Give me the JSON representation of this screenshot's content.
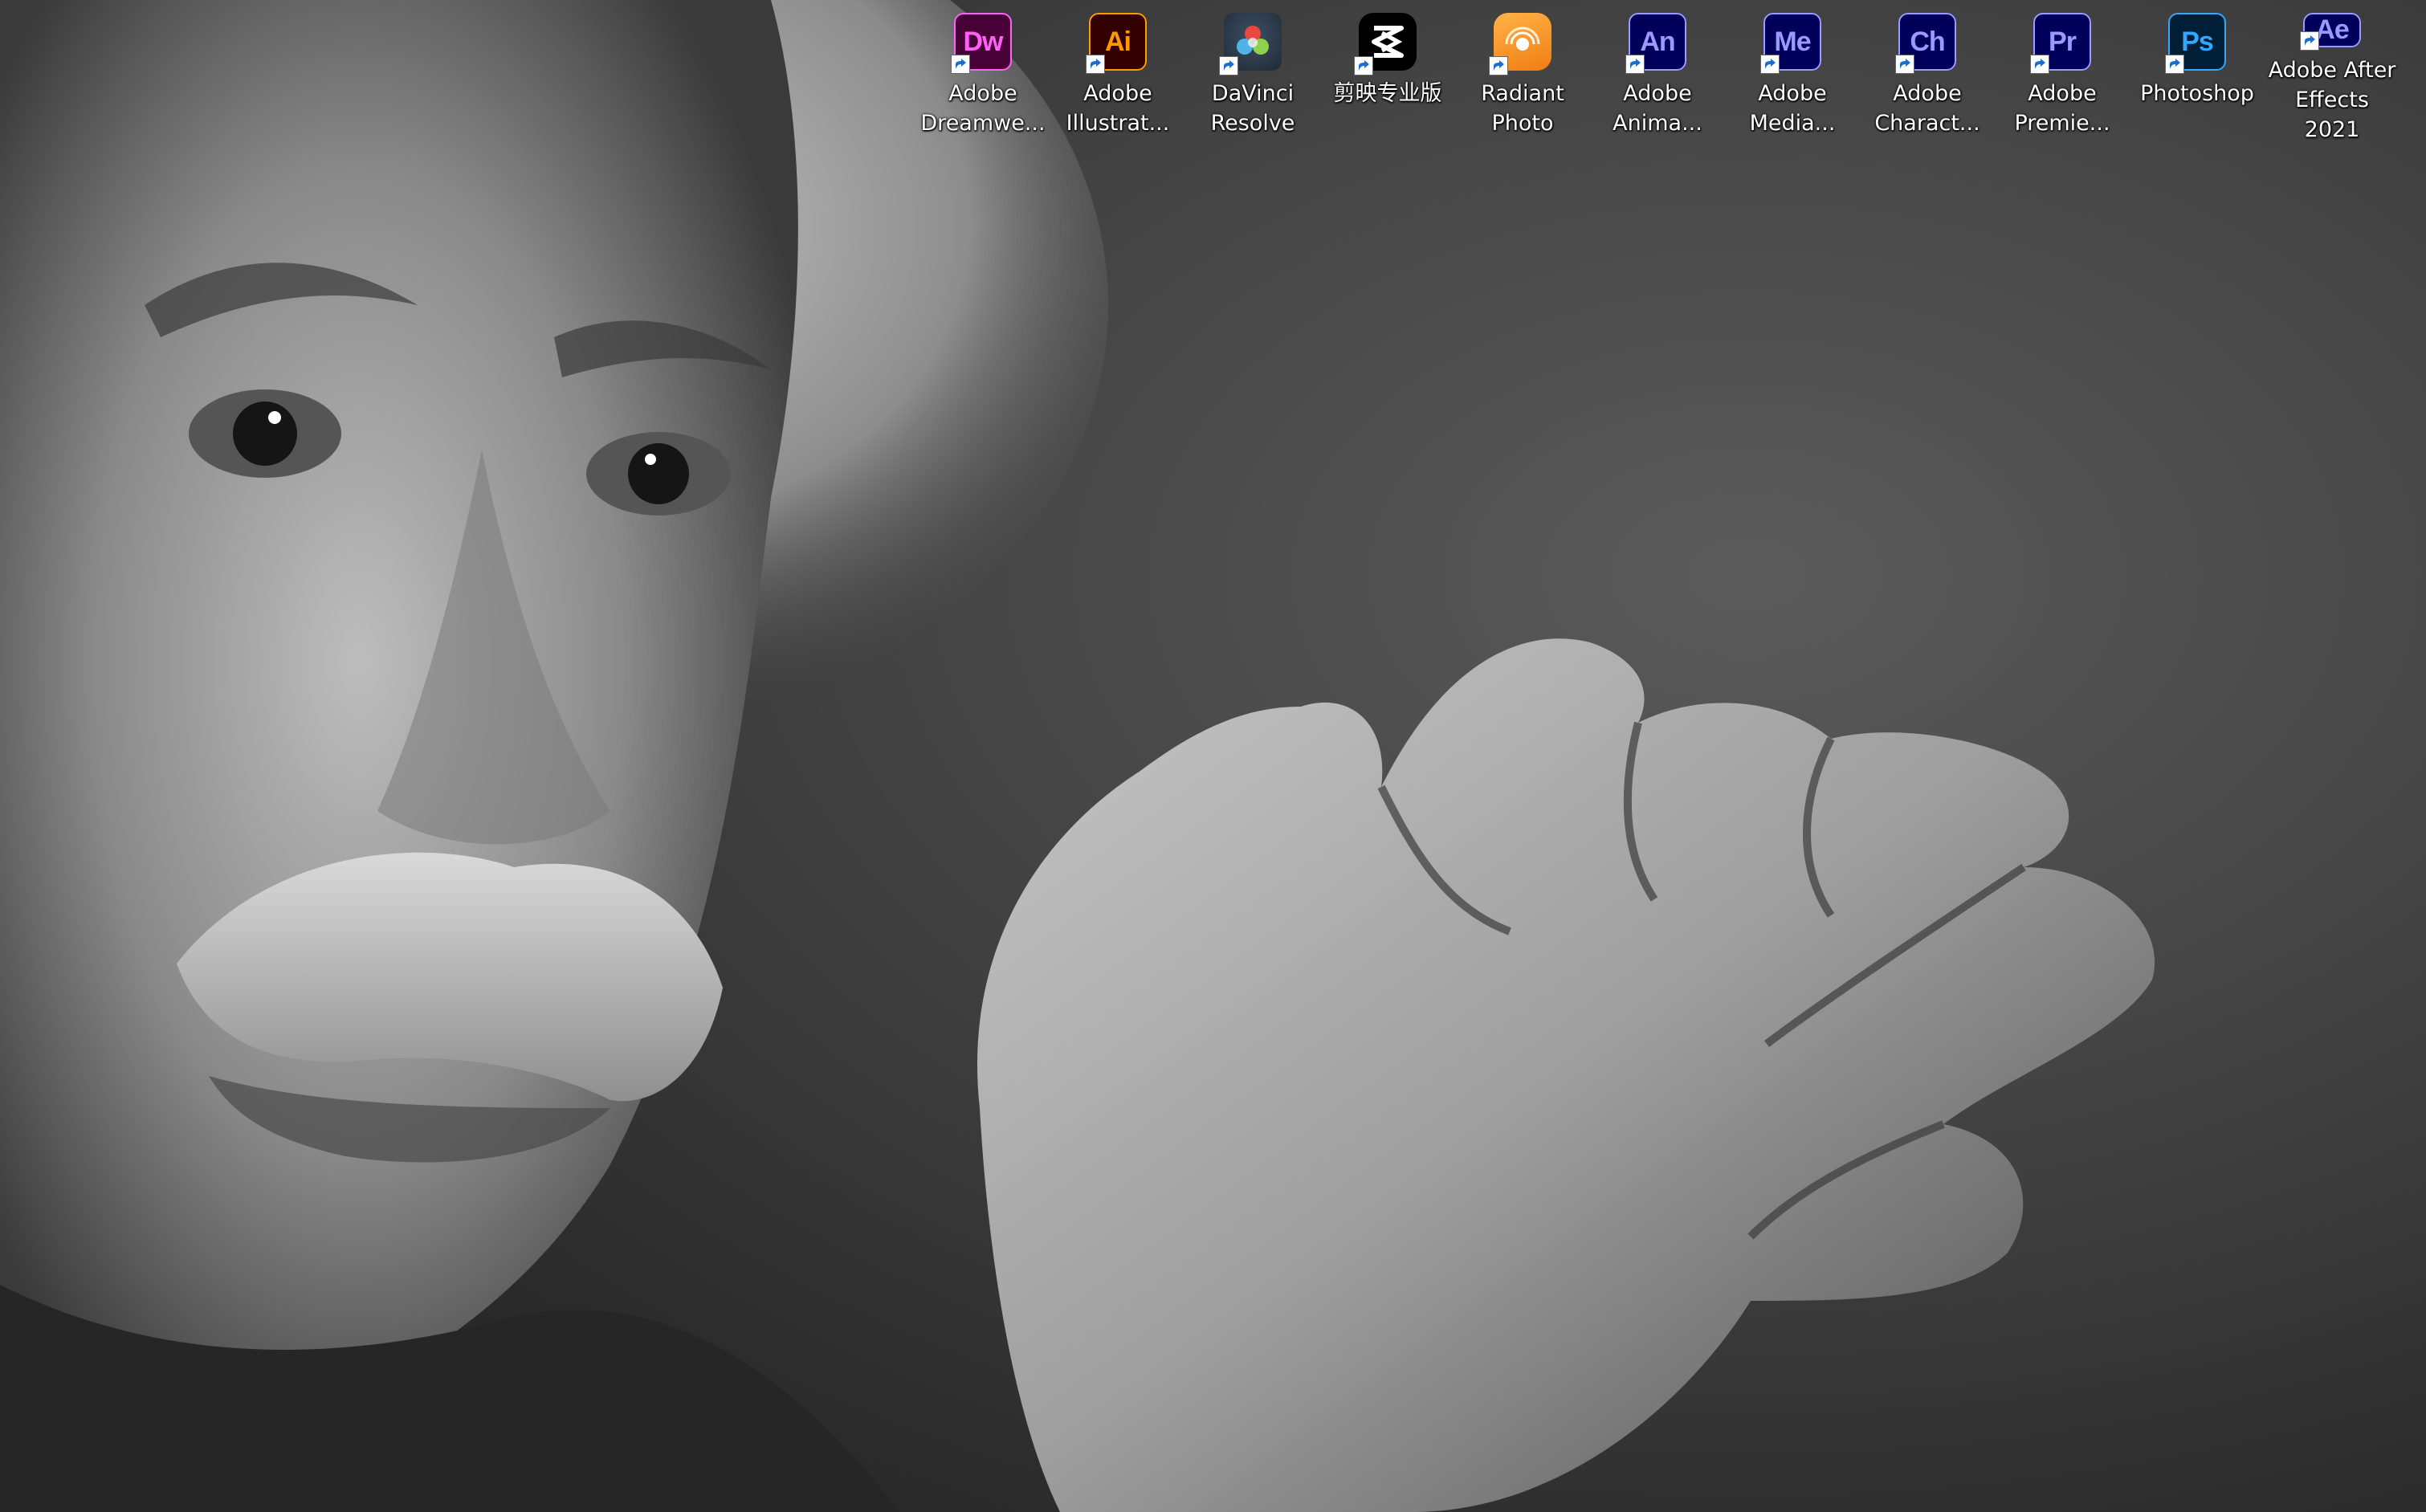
{
  "desktop": {
    "wallpaper": "Black and white portrait photo wallpaper",
    "icons": [
      {
        "id": "dw",
        "label": "Adobe\nDreamwe...",
        "glyph": "Dw",
        "bg": "#470137",
        "fg": "#ff61f6",
        "icon": "dreamweaver-icon"
      },
      {
        "id": "ai",
        "label": "Adobe\nIllustrat...",
        "glyph": "Ai",
        "bg": "#330000",
        "fg": "#ff9a00",
        "icon": "illustrator-icon"
      },
      {
        "id": "dv",
        "label": "DaVinci\nResolve",
        "glyph": "",
        "bg": "#2b3a4a",
        "fg": "#ffffff",
        "icon": "davinci-resolve-icon"
      },
      {
        "id": "jy",
        "label": "剪映专业版",
        "glyph": "",
        "bg": "#000000",
        "fg": "#ffffff",
        "icon": "jianying-icon"
      },
      {
        "id": "rp",
        "label": "Radiant\nPhoto",
        "glyph": "",
        "bg": "#f08a1c",
        "fg": "#ffffff",
        "icon": "radiant-photo-icon"
      },
      {
        "id": "an",
        "label": "Adobe\nAnima...",
        "glyph": "An",
        "bg": "#00005b",
        "fg": "#9999ff",
        "icon": "animate-icon"
      },
      {
        "id": "me",
        "label": "Adobe\nMedia...",
        "glyph": "Me",
        "bg": "#00005b",
        "fg": "#9999ff",
        "icon": "media-encoder-icon"
      },
      {
        "id": "ch",
        "label": "Adobe\nCharact...",
        "glyph": "Ch",
        "bg": "#00005b",
        "fg": "#9999ff",
        "icon": "character-animator-icon"
      },
      {
        "id": "pr",
        "label": "Adobe\nPremie...",
        "glyph": "Pr",
        "bg": "#00005b",
        "fg": "#9999ff",
        "icon": "premiere-icon"
      },
      {
        "id": "ps",
        "label": "Photoshop",
        "glyph": "Ps",
        "bg": "#001e36",
        "fg": "#31a8ff",
        "icon": "photoshop-icon"
      },
      {
        "id": "ae",
        "label": "Adobe After\nEffects 2021",
        "glyph": "Ae",
        "bg": "#00005b",
        "fg": "#9999ff",
        "icon": "after-effects-icon"
      }
    ]
  }
}
